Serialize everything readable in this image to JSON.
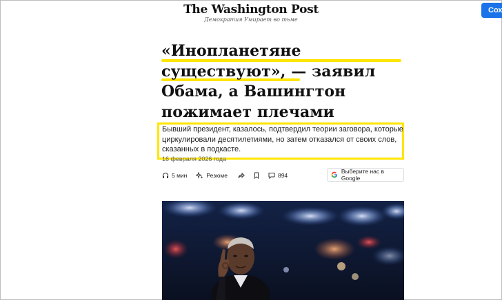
{
  "masthead": {
    "logo": "The Washington Post",
    "tagline": "Демократия Умирает во тьме"
  },
  "subscribe_label": "Сох",
  "article": {
    "headline": "«Инопланетяне существуют», — заявил Обама, а Вашингтон пожимает плечами",
    "lede": "Бывший президент, казалось, подтвердил теории заговора, которые циркулировали десятилетиями, но затем отказался от своих слов, сказанных в подкасте.",
    "date": "16 февраля 2026 года"
  },
  "toolbar": {
    "listen_label": "5 мин",
    "summary_label": "Резюме",
    "comments_count": "894",
    "google_label": "Выберите нас в Google"
  },
  "colors": {
    "highlight": "#ffe500",
    "subscribe": "#1a73e8"
  },
  "icons": [
    "headphones-icon",
    "summary-sparkle-icon",
    "share-icon",
    "bookmark-icon",
    "comment-icon",
    "google-logo-icon"
  ]
}
